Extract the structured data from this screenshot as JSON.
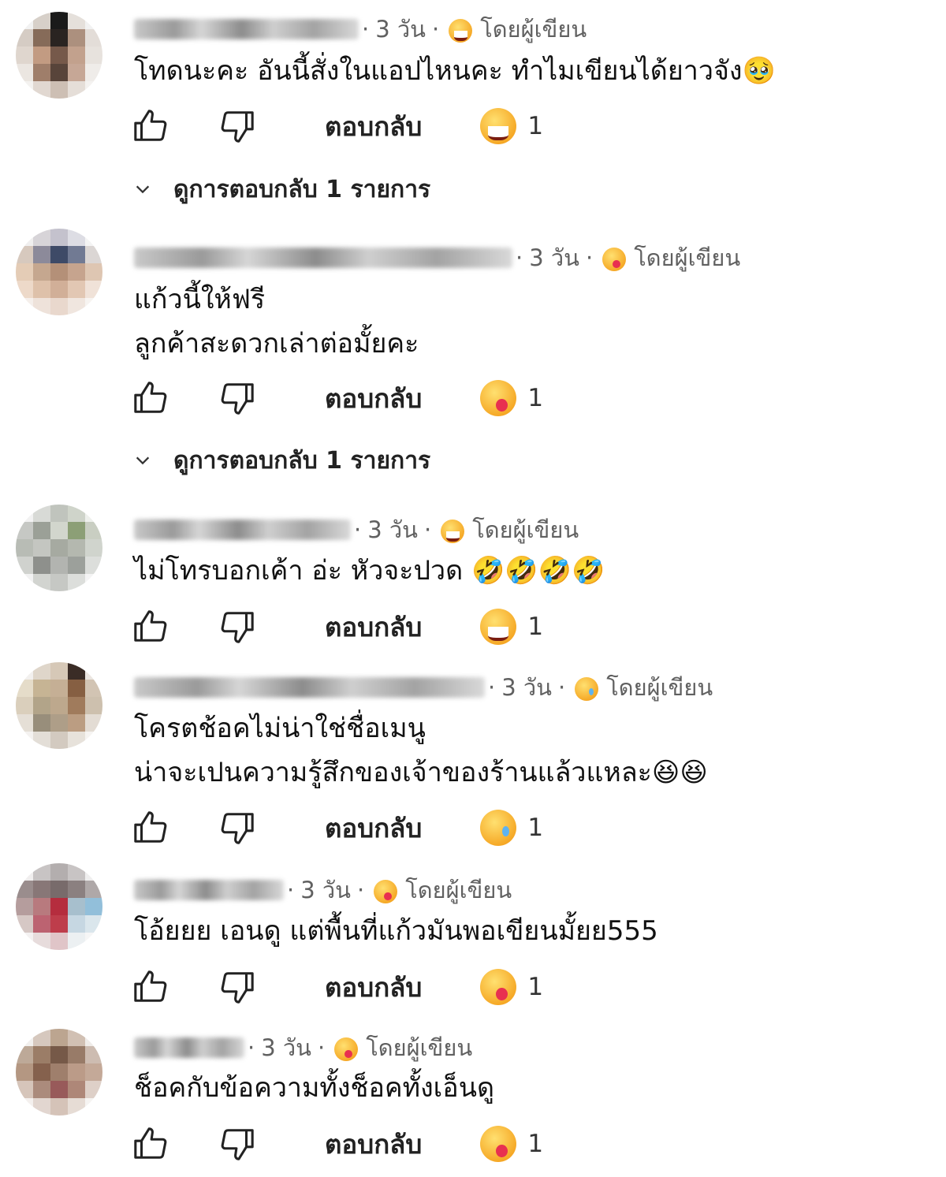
{
  "actions": {
    "reply_label": "ตอบกลับ",
    "view_replies_label": "ดูการตอบกลับ 1 รายการ"
  },
  "comments": [
    {
      "time": "3 วัน",
      "author_reaction_label": "โดยผู้เขียน",
      "author_reaction_icon": "grinning-emoji",
      "lines": [
        "โทดนะคะ อันนี้สั่งในแอปไหนคะ ทำไมเขียนได้ยาวจัง🥹"
      ],
      "reaction_icon": "grinning-emoji",
      "reaction_count": "1",
      "has_replies": true
    },
    {
      "time": "3 วัน",
      "author_reaction_label": "โดยผู้เขียน",
      "author_reaction_icon": "yum-tongue-emoji",
      "lines": [
        "แก้วนี้ให้ฟรี",
        "ลูกค้าสะดวกเล่าต่อมั้ยคะ"
      ],
      "reaction_icon": "yum-tongue-emoji",
      "reaction_count": "1",
      "has_replies": true
    },
    {
      "time": "3 วัน",
      "author_reaction_label": "โดยผู้เขียน",
      "author_reaction_icon": "grinning-emoji",
      "lines": [
        "ไม่โทรบอกเค้า อ่ะ หัวจะปวด 🤣🤣🤣🤣"
      ],
      "reaction_icon": "grinning-emoji",
      "reaction_count": "1",
      "has_replies": false
    },
    {
      "time": "3 วัน",
      "author_reaction_label": "โดยผู้เขียน",
      "author_reaction_icon": "sad-relieved-emoji",
      "lines": [
        "โครตช้อคไม่น่าใช่ชื่อเมนู",
        "น่าจะเปนความรู้สึกของเจ้าของร้านแล้วแหละ😆😆"
      ],
      "reaction_icon": "sad-relieved-emoji",
      "reaction_count": "1",
      "has_replies": false
    },
    {
      "time": "3 วัน",
      "author_reaction_label": "โดยผู้เขียน",
      "author_reaction_icon": "yum-tongue-emoji",
      "lines": [
        "โอ้ยยย เอนดู แต่พื้นที่แก้วมันพอเขียนมั้ยย555"
      ],
      "reaction_icon": "yum-tongue-emoji",
      "reaction_count": "1",
      "has_replies": false
    },
    {
      "time": "3 วัน",
      "author_reaction_label": "โดยผู้เขียน",
      "author_reaction_icon": "yum-tongue-emoji",
      "lines": [
        "ช็อคกับข้อความทั้งช็อคทั้งเอ็นดู"
      ],
      "reaction_icon": "yum-tongue-emoji",
      "reaction_count": "1",
      "has_replies": false
    }
  ]
}
